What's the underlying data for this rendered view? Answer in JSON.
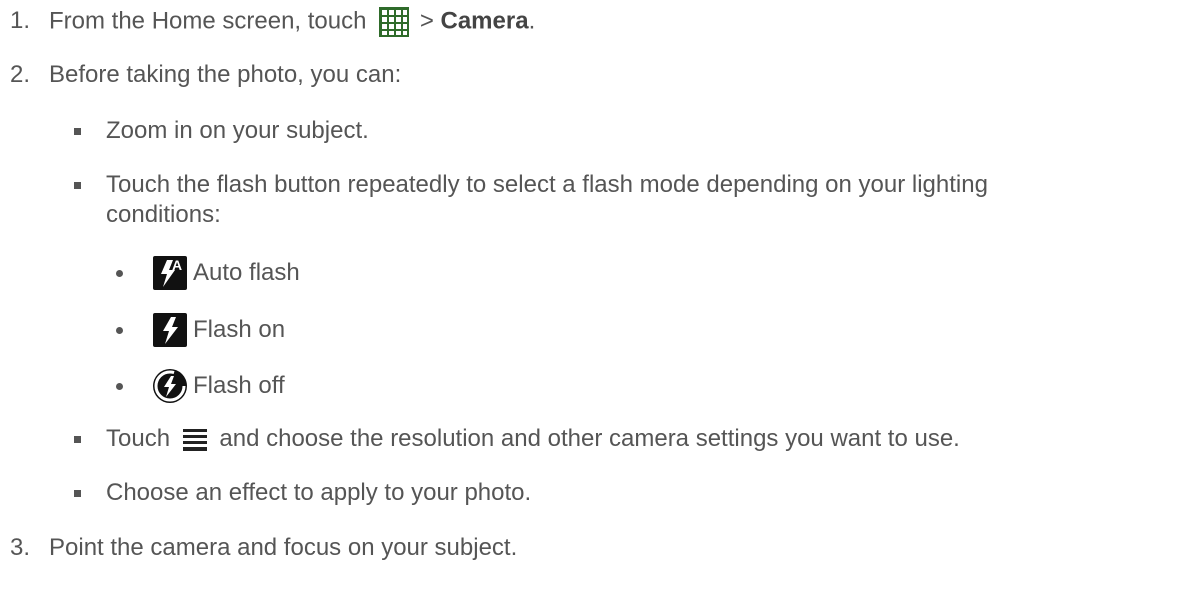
{
  "steps": [
    {
      "number": "1.",
      "pre": "From the Home screen, touch",
      "sep": ">",
      "bold": "Camera",
      "post": "."
    },
    {
      "number": "2.",
      "text": "Before taking the photo, you can:"
    },
    {
      "number": "3.",
      "text": "Point the camera and focus on your subject."
    }
  ],
  "sub_items": {
    "zoom": "Zoom in on your subject.",
    "flash_line1": "Touch the flash button repeatedly to select a flash mode depending on your lighting",
    "flash_line2": "conditions:",
    "menu_pre": "Touch",
    "menu_post": "and choose the resolution and other camera settings you want to use.",
    "effect": "Choose an effect to apply to your photo."
  },
  "flash_modes": [
    {
      "label": "Auto flash",
      "icon": "auto-flash-icon",
      "badge": "A"
    },
    {
      "label": "Flash on",
      "icon": "flash-on-icon"
    },
    {
      "label": "Flash off",
      "icon": "flash-off-icon"
    }
  ],
  "colors": {
    "text": "#555555",
    "icon_bg": "#111111",
    "grid_icon": "#2f6b2a"
  }
}
